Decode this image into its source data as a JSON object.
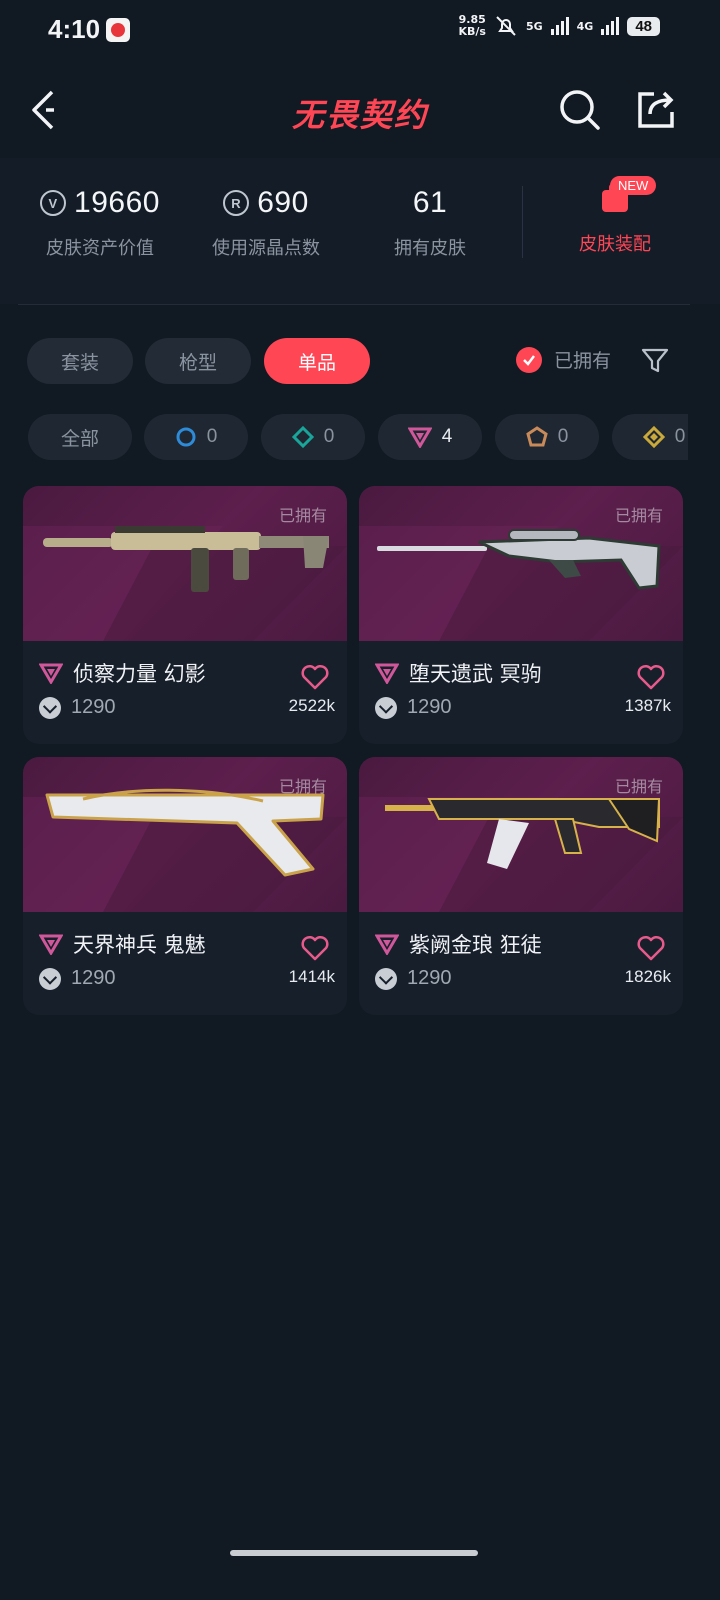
{
  "status_bar": {
    "time": "4:10",
    "speed_value": "9.85",
    "speed_unit": "KB/s",
    "net1": "5G",
    "net2": "4G",
    "battery": "48"
  },
  "header": {
    "title": "无畏契约"
  },
  "stats": {
    "asset_value": "19660",
    "asset_label": "皮肤资产价值",
    "radianite_points": "690",
    "radianite_label": "使用源晶点数",
    "owned_count": "61",
    "owned_label": "拥有皮肤",
    "equip_label": "皮肤装配",
    "new_badge": "NEW"
  },
  "tabs": [
    {
      "label": "套装",
      "active": false
    },
    {
      "label": "枪型",
      "active": false
    },
    {
      "label": "单品",
      "active": true
    }
  ],
  "owned_filter": {
    "label": "已拥有",
    "checked": true
  },
  "rarity_chips": [
    {
      "label": "全部",
      "icon": "all"
    },
    {
      "label": "0",
      "icon": "select-tier-icon",
      "color": "#2d8bd8"
    },
    {
      "label": "0",
      "icon": "deluxe-tier-icon",
      "color": "#1aa59a"
    },
    {
      "label": "4",
      "icon": "premium-tier-icon",
      "color": "#d0579a"
    },
    {
      "label": "0",
      "icon": "ultra-tier-icon",
      "color": "#c98a5a"
    },
    {
      "label": "0",
      "icon": "exclusive-tier-icon",
      "color": "#c9a93a"
    }
  ],
  "skins": [
    {
      "name": "侦察力量 幻影",
      "price": "1290",
      "likes": "2522k",
      "owned": "已拥有"
    },
    {
      "name": "堕天遗武 冥驹",
      "price": "1290",
      "likes": "1387k",
      "owned": "已拥有"
    },
    {
      "name": "天界神兵 鬼魅",
      "price": "1290",
      "likes": "1414k",
      "owned": "已拥有"
    },
    {
      "name": "紫阙金琅 狂徒",
      "price": "1290",
      "likes": "1826k",
      "owned": "已拥有"
    }
  ],
  "colors": {
    "accent": "#ff4655",
    "background": "#111923",
    "card": "#161f2a",
    "premium": "#d0579a"
  }
}
